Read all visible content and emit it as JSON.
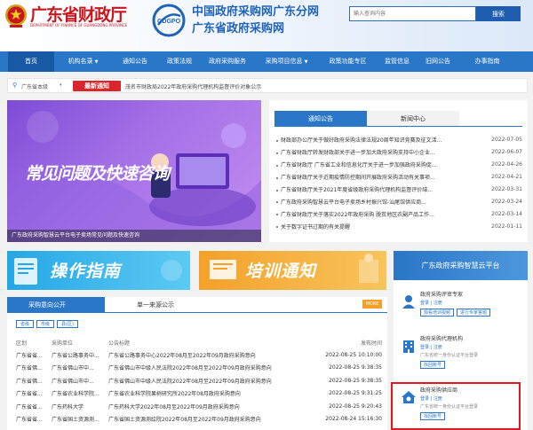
{
  "header": {
    "dept_name": "广东省财政厅",
    "dept_name_en": "DEPARTMENT OF FINANCE OF GUANGDONG PROVINCE",
    "logo_text": "GDGPO",
    "site_title": "中国政府采购网广东分网",
    "site_subtitle": "广东省政府采购网",
    "search_placeholder": "输入查询内容",
    "search_button": "搜索"
  },
  "nav": [
    {
      "label": "首页",
      "active": true
    },
    {
      "label": "机构名录",
      "dropdown": true
    },
    {
      "label": "通知公告"
    },
    {
      "label": "政策法规"
    },
    {
      "label": "政府采购服务"
    },
    {
      "label": "采购项目信息",
      "dropdown": true
    },
    {
      "label": "政策功能专区"
    },
    {
      "label": "监管信息"
    },
    {
      "label": "旧网公告"
    },
    {
      "label": "办事指南"
    }
  ],
  "notice_bar": {
    "location": "广东省本级",
    "latest_label": "最新通知",
    "latest_text": "茂名市财政局2022年政府采购代理机构监督评价对象公示"
  },
  "banner": {
    "title": "常见问题及快速咨询",
    "caption": "广东政府采购智慧云平台电子卖场常见问题及快速咨询"
  },
  "news": {
    "tabs": [
      "通知公告",
      "新闻中心"
    ],
    "items": [
      {
        "title": "财政部办公厅关于做好政府采购法律法规20周年知识竞赛及征文活...",
        "date": "2022-07-05"
      },
      {
        "title": "广东省财政厅转发财政部关于进一步加大政府采购支持中小企业...",
        "date": "2022-06-07"
      },
      {
        "title": "广东省财政厅 广东省工业和信息化厅关于进一步加强政府采购促...",
        "date": "2022-04-26"
      },
      {
        "title": "广东省财政厅关于近期疫情防控期间开展政府采购活动有关事项...",
        "date": "2022-04-21"
      },
      {
        "title": "广东省财政厅关于2021年度省级政府采购代理机构监督评价结...",
        "date": "2022-03-31"
      },
      {
        "title": "广东政府采购智慧云平台电子卖场乡村振兴馆-汕尾馆供应商...",
        "date": "2022-03-24"
      },
      {
        "title": "广东省财政厅关于落实2022年政府采购 脱贫地区农副产品工作...",
        "date": "2022-03-14"
      },
      {
        "title": "关于数字证书过期的有关提醒",
        "date": "2022-01-11"
      }
    ]
  },
  "promo": {
    "guide": "操作指南",
    "training": "培训通知"
  },
  "procurement": {
    "tab_active": "采购意向公开",
    "tab_other": "单一来源公示",
    "more": "MORE",
    "filters": [
      "省级",
      "市级",
      "县(区)"
    ],
    "columns": [
      "区划",
      "采购单位",
      "公告标题",
      "发布时间"
    ],
    "rows": [
      [
        "广东省省...",
        "广东省公路事务中...",
        "广东省公路事务中心2022年08月至2022年09月政府采购意向",
        "2022-08-25 10:10:00"
      ],
      [
        "广东省佛...",
        "广东省佛山市中...",
        "广东省佛山市中级人民法院2022年08月至2022年09月政府采购意向",
        "2022-08-25 9:38:35"
      ],
      [
        "广东省佛...",
        "广东省佛山市中...",
        "广东省佛山市中级人民法院2022年08月至2022年09月政府采购意向",
        "2022-08-25 9:38:35"
      ],
      [
        "广东省省...",
        "广东省农业科学院...",
        "广东省农业科学院果树研究所2022年08月政府采购意向",
        "2022-08-25 9:31:25"
      ],
      [
        "广东省省...",
        "广东药科大学",
        "广东药科大学2022年08月至2022年09月政府采购意向",
        "2022-08-25 9:20:43"
      ],
      [
        "广东省省...",
        "广东省国土资源测...",
        "广东省国土资源测绘院2022年08月至2022年09月政府采购意向",
        "2022-08-24 15:16:30"
      ]
    ]
  },
  "platform": {
    "title": "广东政府采购智慧云平台",
    "sections": [
      {
        "title": "政府采购评审专家",
        "links": "登录 | 注册",
        "buttons": [
          "观看培训视频",
          "进行专家答题"
        ]
      },
      {
        "title": "政府采购代理机构",
        "links": "登录 | 注册",
        "sub": "广东省统一身份认证平台登录",
        "buttons": [
          "找回账号"
        ]
      },
      {
        "title": "政府采购供应商",
        "links": "登录 | 注册",
        "sub": "广东省统一身份认证平台登录",
        "buttons": [
          "找回账号"
        ]
      }
    ]
  }
}
